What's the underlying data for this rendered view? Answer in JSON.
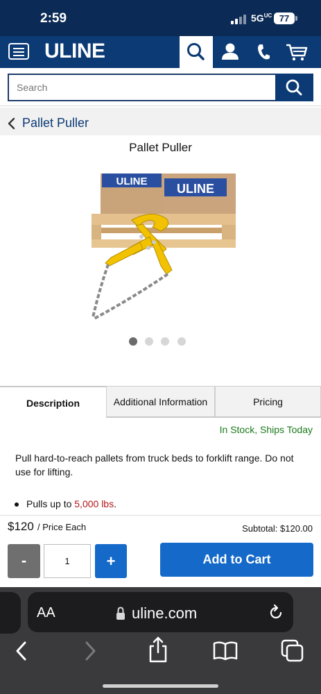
{
  "status_bar": {
    "time": "2:59",
    "network": "5G",
    "network_suffix": "UC",
    "battery": "77"
  },
  "header": {
    "brand": "ULINE"
  },
  "search": {
    "placeholder": "Search"
  },
  "breadcrumb": {
    "label": "Pallet Puller"
  },
  "product": {
    "title": "Pallet Puller",
    "image_box_label_1": "ULINE",
    "image_box_label_2": "ULINE",
    "carousel_count": 4,
    "carousel_active": 0
  },
  "tabs": [
    {
      "label": "Description"
    },
    {
      "label": "Additional Information"
    },
    {
      "label": "Pricing"
    }
  ],
  "stock": "In Stock, Ships Today",
  "description": "Pull hard-to-reach pallets from truck beds to forklift range. Do not use for lifting.",
  "bullets": [
    {
      "prefix": "Pulls up to ",
      "highlight": "5,000 lbs",
      "suffix": "."
    }
  ],
  "purchase": {
    "price": "$120",
    "price_unit": "/ Price Each",
    "subtotal": "Subtotal: $120.00",
    "minus": "-",
    "quantity": "1",
    "plus": "+",
    "add_to_cart": "Add to Cart"
  },
  "browser": {
    "text_size": "AA",
    "url": "uline.com"
  },
  "colors": {
    "brand_navy": "#0b3a75",
    "action_blue": "#1469c9",
    "stock_green": "#1a7a1a",
    "price_red": "#b3161b"
  }
}
